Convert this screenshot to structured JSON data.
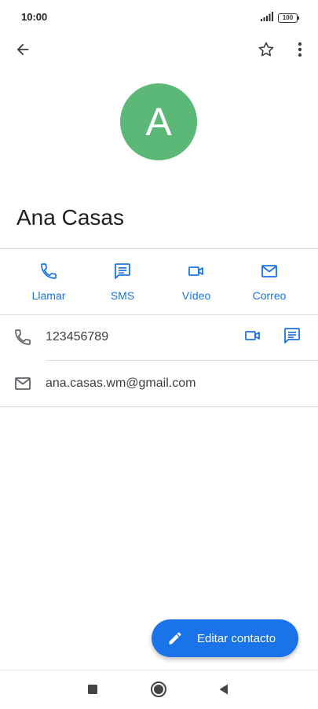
{
  "status_bar": {
    "time": "10:00",
    "battery": "100",
    "signal_icon": "signal-icon",
    "battery_icon": "battery-icon"
  },
  "app_bar": {
    "back_icon": "arrow-back-icon",
    "star_icon": "star-outline-icon",
    "more_icon": "more-vert-icon"
  },
  "contact": {
    "initial": "A",
    "name": "Ana Casas",
    "avatar_color": "#5cb877"
  },
  "actions": [
    {
      "label": "Llamar",
      "icon": "phone-icon"
    },
    {
      "label": "SMS",
      "icon": "message-icon"
    },
    {
      "label": "Vídeo",
      "icon": "video-icon"
    },
    {
      "label": "Correo",
      "icon": "mail-icon"
    }
  ],
  "details": {
    "phone": "123456789",
    "email": "ana.casas.wm@gmail.com"
  },
  "fab": {
    "label": "Editar contacto",
    "icon": "pencil-icon"
  },
  "nav": {
    "recents_icon": "square-icon",
    "home_icon": "circle-icon",
    "back_icon": "triangle-back-icon"
  },
  "colors": {
    "accent": "#1a73e8",
    "text": "#202124",
    "divider": "#dadce0"
  }
}
